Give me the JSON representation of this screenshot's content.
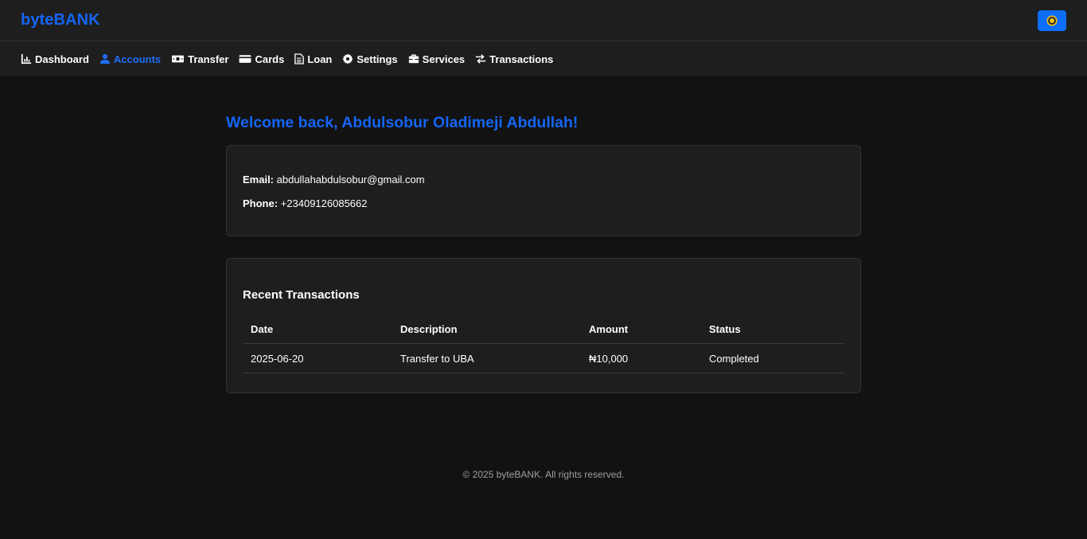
{
  "app": {
    "brand": "byteBANK",
    "theme_toggle_icon": "sun-icon",
    "accent": "#1565f4"
  },
  "nav": [
    {
      "label": "Dashboard",
      "icon": "chart-icon",
      "active": false
    },
    {
      "label": "Accounts",
      "icon": "user-icon",
      "active": true
    },
    {
      "label": "Transfer",
      "icon": "money-icon",
      "active": false
    },
    {
      "label": "Cards",
      "icon": "card-icon",
      "active": false
    },
    {
      "label": "Loan",
      "icon": "document-icon",
      "active": false
    },
    {
      "label": "Settings",
      "icon": "gear-icon",
      "active": false
    },
    {
      "label": "Services",
      "icon": "toolbox-icon",
      "active": false
    },
    {
      "label": "Transactions",
      "icon": "exchange-icon",
      "active": false
    }
  ],
  "welcome": "Welcome back, Abdulsobur Oladimeji Abdullah!",
  "profile": {
    "email_label": "Email:",
    "email": "abdullahabdulsobur@gmail.com",
    "phone_label": "Phone:",
    "phone": "+23409126085662"
  },
  "transactions": {
    "title": "Recent Transactions",
    "headers": {
      "date": "Date",
      "description": "Description",
      "amount": "Amount",
      "status": "Status"
    },
    "rows": [
      {
        "date": "2025-06-20",
        "description": "Transfer to UBA",
        "amount": "₦10,000",
        "status": "Completed"
      }
    ]
  },
  "footer": "© 2025 byteBANK. All rights reserved."
}
